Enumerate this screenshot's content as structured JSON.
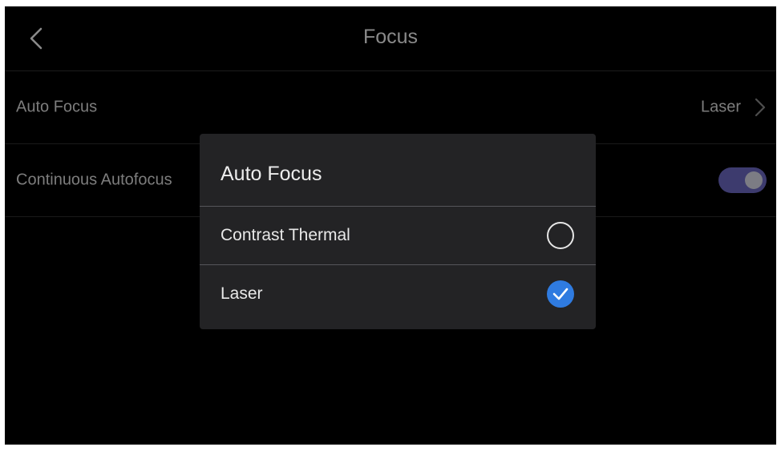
{
  "header": {
    "title": "Focus",
    "back_icon": "chevron-left-icon"
  },
  "settings": {
    "auto_focus": {
      "label": "Auto Focus",
      "value": "Laser",
      "chevron_icon": "chevron-right-icon"
    },
    "continuous_autofocus": {
      "label": "Continuous Autofocus",
      "enabled": true
    }
  },
  "dialog": {
    "title": "Auto Focus",
    "options": [
      {
        "label": "Contrast Thermal",
        "selected": false
      },
      {
        "label": "Laser",
        "selected": true
      }
    ]
  },
  "colors": {
    "background": "#000000",
    "dialog_background": "#232325",
    "accent": "#2f7be0",
    "toggle_track": "#3d3b6e",
    "muted_text": "#7d7d7d"
  }
}
